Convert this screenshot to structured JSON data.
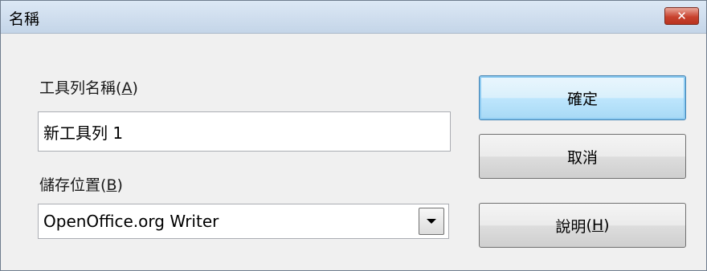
{
  "window": {
    "title": "名稱",
    "close_glyph": "✕"
  },
  "form": {
    "toolbar_name_label": "工具列名稱",
    "toolbar_name_mnemonic": "A",
    "toolbar_name_value": "新工具列 1",
    "save_location_label": "儲存位置",
    "save_location_mnemonic": "B",
    "save_location_value": "OpenOffice.org Writer"
  },
  "buttons": {
    "ok_label": "確定",
    "cancel_label": "取消",
    "help_label": "說明",
    "help_mnemonic": "H"
  },
  "icons": {
    "close": "close-icon",
    "dropdown": "chevron-down-icon"
  }
}
